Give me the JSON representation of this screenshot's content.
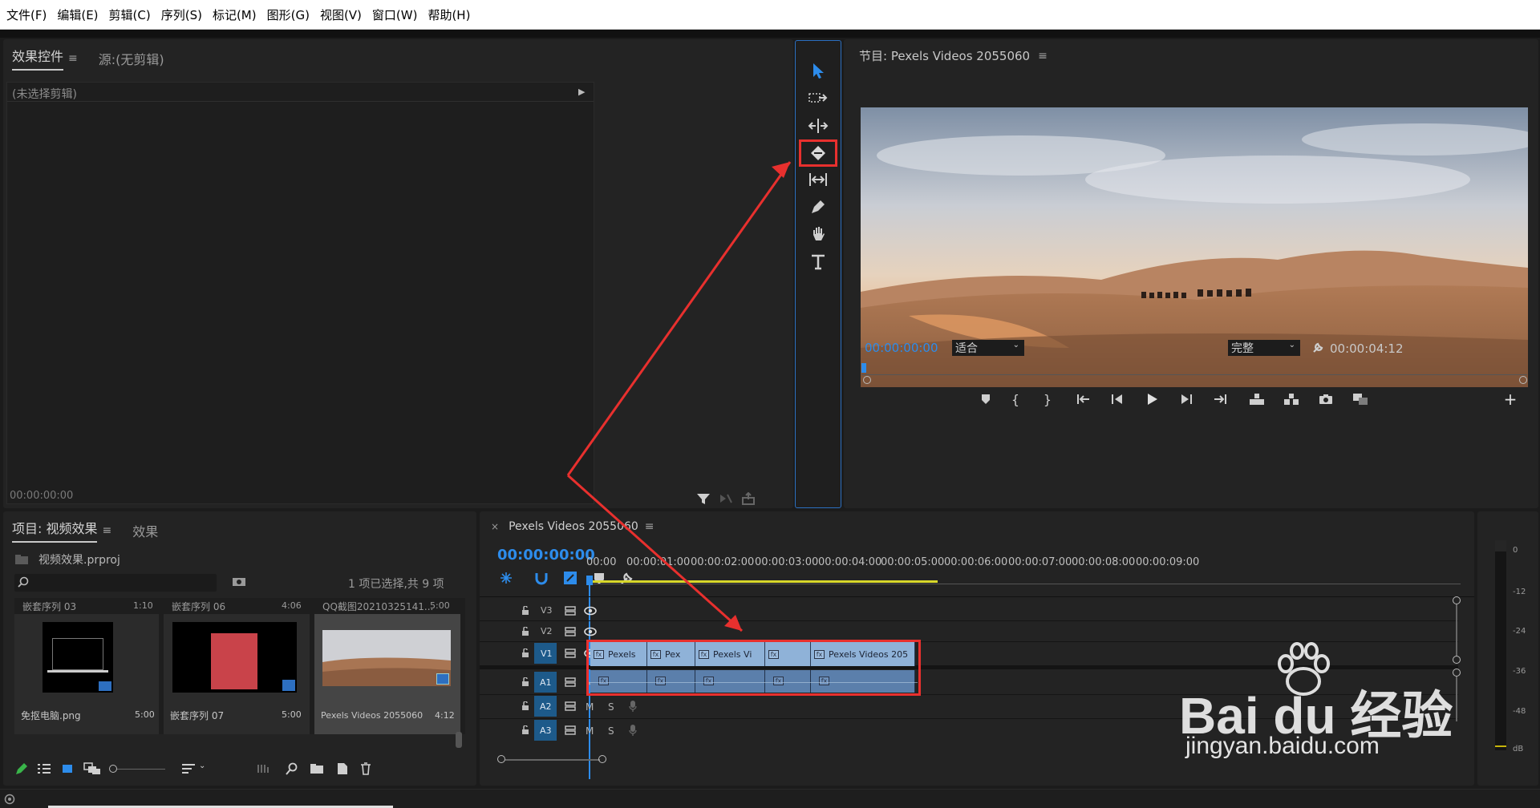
{
  "menu": [
    "文件(F)",
    "编辑(E)",
    "剪辑(C)",
    "序列(S)",
    "标记(M)",
    "图形(G)",
    "视图(V)",
    "窗口(W)",
    "帮助(H)"
  ],
  "effects_panel": {
    "tab_active": "效果控件",
    "tab_source": "源:(无剪辑)",
    "no_clip": "(未选择剪辑)",
    "timecode": "00:00:00:00"
  },
  "tools": [
    "selection-tool-icon",
    "track-select-tool-icon",
    "ripple-edit-tool-icon",
    "razor-tool-icon",
    "slip-tool-icon",
    "pen-tool-icon",
    "hand-tool-icon",
    "type-tool-icon"
  ],
  "program": {
    "title": "节目: Pexels Videos 2055060",
    "timecode": "00:00:00:00",
    "fit": "适合",
    "quality": "完整",
    "duration": "00:00:04:12"
  },
  "project": {
    "tab_active": "项目: 视频效果",
    "tab_effects": "效果",
    "file": "视频效果.prproj",
    "selection_info": "1 项已选择,共 9 项",
    "top_row": [
      {
        "name": "嵌套序列 03",
        "dur": "1:10"
      },
      {
        "name": "嵌套序列 06",
        "dur": "4:06"
      },
      {
        "name": "QQ截图20210325141...",
        "dur": "5:00"
      }
    ],
    "items": [
      {
        "name": "免抠电脑.png",
        "dur": "5:00"
      },
      {
        "name": "嵌套序列 07",
        "dur": "5:00"
      },
      {
        "name": "Pexels Videos 2055060",
        "dur": "4:12"
      }
    ]
  },
  "timeline": {
    "tab": "Pexels Videos 2055060",
    "timecode": "00:00:00:00",
    "ruler": [
      "00:00",
      "00:00:01:00",
      "00:00:02:00",
      "00:00:03:00",
      "00:00:04:00",
      "00:00:05:00",
      "00:00:06:00",
      "00:00:07:00",
      "00:00:08:00",
      "00:00:09:00"
    ],
    "video_tracks": [
      "V3",
      "V2",
      "V1"
    ],
    "audio_tracks": [
      "A1",
      "A2",
      "A3"
    ],
    "m": "M",
    "s": "S",
    "clips": [
      "Pexels",
      "Pex",
      "Pexels Vi",
      "",
      "Pexels Videos 205"
    ],
    "fx_label": "fx"
  },
  "meter": {
    "labels": [
      "0",
      "-12",
      "-24",
      "-36",
      "-48",
      "dB"
    ]
  },
  "watermark": {
    "logo": "Bai du 经验",
    "url": "jingyan.baidu.com"
  },
  "colors": {
    "accent_blue": "#2d8ceb",
    "annotation_red": "#e8302e",
    "clip_blue": "#8fb2d8",
    "work_area_yellow": "#d7d72a"
  }
}
